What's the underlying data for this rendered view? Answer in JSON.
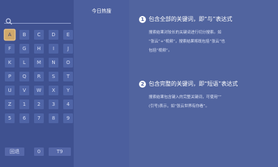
{
  "sidebar": {
    "search": {
      "placeholder": ""
    },
    "keys": [
      "A",
      "B",
      "C",
      "D",
      "E",
      "F",
      "G",
      "H",
      "I",
      "J",
      "K",
      "L",
      "M",
      "N",
      "O",
      "P",
      "Q",
      "R",
      "S",
      "T",
      "U",
      "V",
      "W",
      "X",
      "Y",
      "Z",
      "1",
      "2",
      "3",
      "4",
      "5",
      "6",
      "7",
      "8",
      "9"
    ],
    "selected_key": "A",
    "bottom": {
      "back_label": "回退",
      "zero_label": "0",
      "t9_label": "T9"
    }
  },
  "middle": {
    "title": "今日热搜"
  },
  "tips": [
    {
      "number": "1",
      "heading": "包含全部的关键词，即“与”表达式",
      "lines": [
        "搜索结果对较长的关键词进行切分搜索。如",
        "“张云”+“视频”，搜索结果将既包括“张云”也",
        "包括“视频”。"
      ]
    },
    {
      "number": "2",
      "heading": "包含完整的关键词，即“短语”表达式",
      "lines": [
        "搜索结果包含键入的完整关键词，可使用“”",
        "(引号)表示，如“张云世界有你看”。"
      ]
    }
  ],
  "colors": {
    "background": "#4a5d9c",
    "key": "#4f64a6",
    "selected_key": "#d0a86b"
  }
}
